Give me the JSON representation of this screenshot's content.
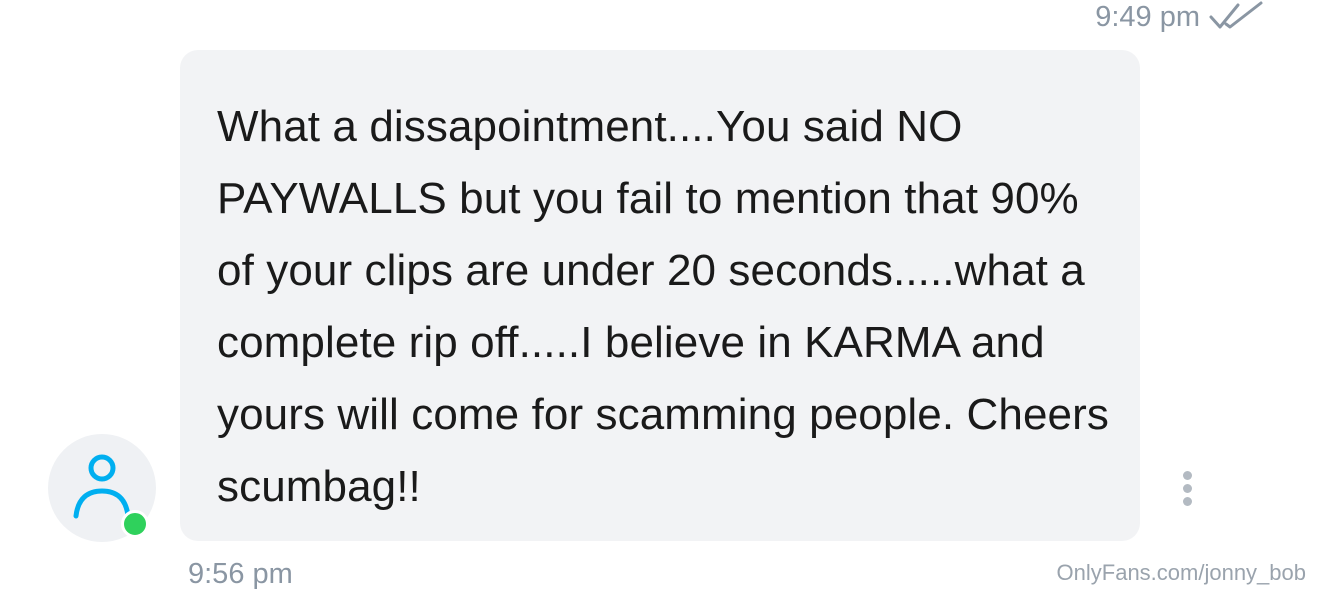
{
  "previous_message": {
    "time": "9:49 pm",
    "status_icon": "double-check-icon"
  },
  "message": {
    "text": "What a dissapointment....You said NO PAYWALLS but you fail to mention that 90% of your clips are under 20 seconds.....what a complete rip off.....I believe in KARMA and yours will come for scamming people. Cheers scumbag!!",
    "time": "9:56 pm"
  },
  "sender": {
    "avatar_icon": "user-icon",
    "online": true
  },
  "menu_icon": "more-vertical-icon",
  "watermark": "OnlyFans.com/jonny_bob",
  "colors": {
    "bubble": "#f2f3f5",
    "text": "#1a1a1a",
    "meta": "#8a96a3",
    "accent": "#00aff0",
    "online": "#2fd15c"
  }
}
